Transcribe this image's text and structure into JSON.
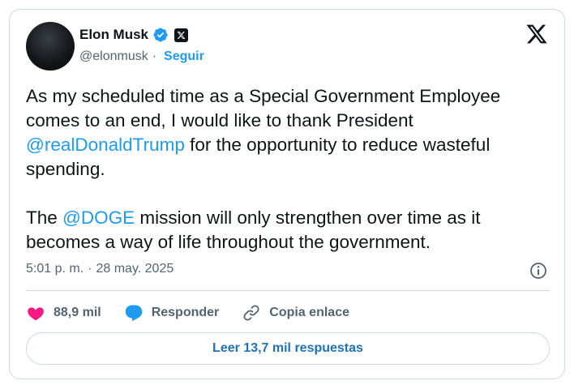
{
  "author": {
    "name": "Elon Musk",
    "handle": "@elonmusk",
    "separator": "·",
    "follow_label": "Seguir"
  },
  "tweet": {
    "paragraph1": {
      "before": "As my scheduled time as a Special Government Employee comes to an end, I would like to thank President ",
      "mention": "@realDonaldTrump",
      "after": " for the opportunity to reduce wasteful spending."
    },
    "paragraph2": {
      "before": "The ",
      "mention": "@DOGE",
      "after": " mission will only strengthen over time as it becomes a way of life throughout the government."
    }
  },
  "meta": {
    "time": "5:01 p. m.",
    "separator": "·",
    "date": "28 may. 2025"
  },
  "actions": {
    "likes": "88,9 mil",
    "reply_label": "Responder",
    "copy_link_label": "Copia enlace"
  },
  "read_replies_label": "Leer 13,7 mil respuestas",
  "colors": {
    "accent": "#1d9bf0",
    "like": "#f91880",
    "text": "#0f1419",
    "secondary": "#536471",
    "border": "#cfd9de"
  },
  "icons": [
    "verified-badge-icon",
    "x-affiliate-icon",
    "x-logo-icon",
    "info-icon",
    "heart-icon",
    "reply-bubble-icon",
    "link-icon"
  ]
}
